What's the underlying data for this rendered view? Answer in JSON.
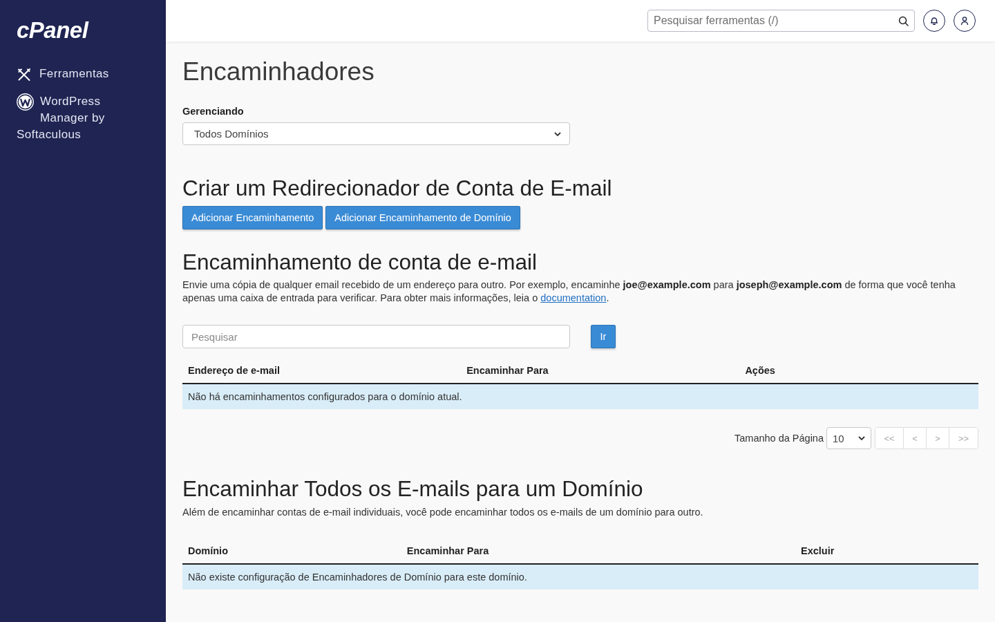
{
  "sidebar": {
    "logo": "cPanel",
    "items": [
      {
        "kind": "tools",
        "label": "Ferramentas"
      },
      {
        "kind": "wordpress",
        "label": "WordPress Manager by Softaculous"
      }
    ]
  },
  "topbar": {
    "search": {
      "placeholder": "Pesquisar ferramentas (/)"
    },
    "buttons": [
      {
        "kind": "notifications"
      },
      {
        "kind": "user"
      }
    ]
  },
  "page": {
    "title": "Encaminhadores",
    "managing": {
      "label": "Gerenciando",
      "value": "Todos Domínios"
    }
  },
  "create_section": {
    "title": "Criar um Redirecionador de Conta de E-mail",
    "buttons": [
      "Adicionar Encaminhamento",
      "Adicionar Encaminhamento de Domínio"
    ]
  },
  "account_forwarders": {
    "title": "Encaminhamento de conta de e-mail",
    "description": "Envie uma cópia de qualquer email recebido de um endereço para outro. Por exemplo, encaminhe **joe@example.com** para **joseph@example.com** de forma que você tenha apenas uma caixa de entrada para verificar. Para obter mais informações, leia o",
    "link": "documentation",
    "description_end": ".",
    "search": {
      "placeholder": "Pesquisar"
    },
    "search_button": "Ir",
    "table": {
      "columns": [
        "Endereço de e-mail",
        "Encaminhar Para",
        "Ações"
      ],
      "empty_message": "Não há encaminhamentos configurados para o domínio atual."
    },
    "pagination": {
      "page_size_label": "Tamanho da Página",
      "page_size": "10",
      "buttons": [
        {
          "label": "<<",
          "disabled": true
        },
        {
          "label": "<",
          "disabled": true
        },
        {
          "label": ">",
          "disabled": true
        },
        {
          "label": ">>",
          "disabled": true
        }
      ]
    }
  },
  "domain_forwarders": {
    "title": "Encaminhar Todos os E-mails para um Domínio",
    "description": "Além de encaminhar contas de e-mail individuais, você pode encaminhar todos os e-mails de um domínio para outro.",
    "table": {
      "columns": [
        "Domínio",
        "Encaminhar Para",
        "Excluir"
      ],
      "empty_message": "Não existe configuração de Encaminhadores de Domínio para este domínio."
    }
  }
}
